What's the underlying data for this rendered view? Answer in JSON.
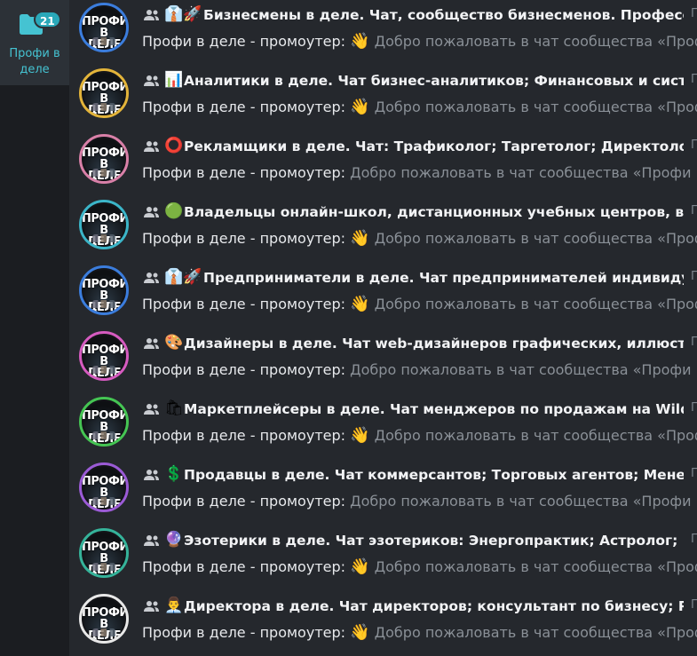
{
  "sidebar": {
    "folder": {
      "badge": "21",
      "label": "Профи в деле"
    }
  },
  "chats": [
    {
      "emoji": "👔🚀",
      "title": "Бизнесмены в деле. Чат, сообщество бизнесменов. Профессиона…",
      "sender": "Профи в деле - промоутер:",
      "wave": "👋",
      "text": " Добро пожаловать в чат сообщества «Профи в дел",
      "ring": "#3b7ddd"
    },
    {
      "emoji": "📊",
      "title": "Аналитики в деле. Чат бизнес-аналитиков; Финансовых и системны…",
      "sender": "Профи в деле - промоутер:",
      "wave": "👋",
      "text": " Добро пожаловать в чат сообщества «Профи в дел",
      "ring": "#e3b43a"
    },
    {
      "emoji": "⭕",
      "title": "Рекламщики в деле. Чат: Трафиколог; Таргетолог; Директолог; Креа…",
      "sender": "Профи в деле - промоутер:",
      "wave": "",
      "text": " Добро пожаловать в чат сообщества «Профи в деле»",
      "ring": "#d980a8"
    },
    {
      "emoji": "🟢",
      "title": "Владельцы онлайн-школ, дистанционных учебных центров, виртуа…",
      "sender": "Профи в деле - промоутер:",
      "wave": "👋",
      "text": " Добро пожаловать в чат сообщества «Профи в дел",
      "ring": "#3bb5c8"
    },
    {
      "emoji": "👔🚀",
      "title": "Предприниматели в деле. Чат предпринимателей индивидуаль…",
      "sender": "Профи в деле - промоутер:",
      "wave": "👋",
      "text": " Добро пожаловать в чат сообщества «Профи в дел",
      "ring": "#3b7ddd"
    },
    {
      "emoji": "🎨",
      "title": "Дизайнеры в деле. Чат web-дизайнеров графических, иллюстратор…",
      "sender": "Профи в деле - промоутер:",
      "wave": "",
      "text": " Добро пожаловать в чат сообщества «Профи в деле»",
      "ring": "#d65bc0"
    },
    {
      "emoji": "🛍",
      "title": "Маркетплейсеры в деле. Чат менджеров по продажам на Wildberrie…",
      "sender": "Профи в деле - промоутер:",
      "wave": "👋",
      "text": " Добро пожаловать в чат сообщества «Профи в дел",
      "ring": "#45c553"
    },
    {
      "emoji": "💲",
      "title": "Продавцы в деле. Чат коммерсантов; Торговых агентов; Менеджер…",
      "sender": "Профи в деле - промоутер:",
      "wave": "",
      "text": " Добро пожаловать в чат сообщества «Профи в деле»",
      "ring": "#9b5bd6"
    },
    {
      "emoji": "🔮",
      "title": "Эзотерики в деле. Чат эзотериков: Энергопрактик; Астролог; Нумер…",
      "sender": "Профи в деле - промоутер:",
      "wave": "👋",
      "text": " Добро пожаловать в чат сообщества «Профи в дел",
      "ring": "#35b39a"
    },
    {
      "emoji": "👨‍💼",
      "title": "Директора в деле. Чат директоров; консультант по бизнесу; Руково…",
      "sender": "Профи в деле - промоутер:",
      "wave": "👋",
      "text": " Добро пожаловать в чат сообщества «Профи в дел",
      "ring": "#e8e8e8"
    }
  ],
  "avatar_logo": {
    "line1": "ПРОФИ",
    "line2": "В ДЕЛЕ"
  }
}
